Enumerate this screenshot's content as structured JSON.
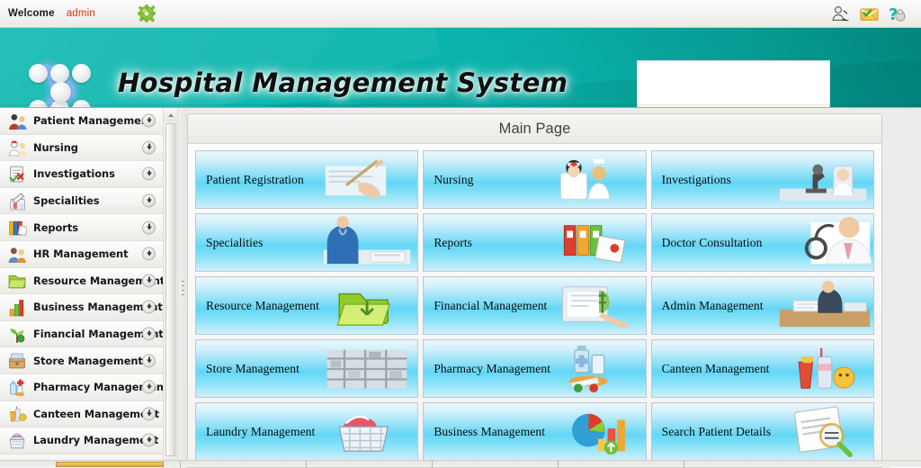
{
  "topbar": {
    "welcome_label": "Welcome",
    "user_name": "admin",
    "gear_icon": "gear-icon",
    "right_icons": [
      {
        "name": "user-account-icon",
        "glyph": "user"
      },
      {
        "name": "mail-envelope-icon",
        "glyph": "envelope"
      },
      {
        "name": "help-question-icon",
        "glyph": "question"
      }
    ]
  },
  "banner": {
    "title": "Hospital Management System",
    "logo_name": "molecule-logo",
    "placeholder_box_name": "banner-logo-placeholder"
  },
  "sidebar": {
    "items": [
      {
        "label": "Patient Management",
        "icon": "patients-icon"
      },
      {
        "label": "Nursing",
        "icon": "nurse-icon"
      },
      {
        "label": "Investigations",
        "icon": "clipboard-icon"
      },
      {
        "label": "Specialities",
        "icon": "specialities-icon"
      },
      {
        "label": "Reports",
        "icon": "binders-icon"
      },
      {
        "label": "HR Management",
        "icon": "people-icon"
      },
      {
        "label": "Resource Management",
        "icon": "folder-icon"
      },
      {
        "label": "Business Management",
        "icon": "bar-chart-icon"
      },
      {
        "label": "Financial Management",
        "icon": "money-plant-icon"
      },
      {
        "label": "Store Management",
        "icon": "store-box-icon"
      },
      {
        "label": "Pharmacy Management",
        "icon": "medicine-icon"
      },
      {
        "label": "Canteen Management",
        "icon": "food-icon"
      },
      {
        "label": "Laundry Management",
        "icon": "laundry-icon"
      }
    ],
    "expand_arrow_name": "expand-arrow-icon"
  },
  "main": {
    "page_title": "Main Page",
    "tiles": [
      {
        "label": "Patient Registration",
        "art": "hand-writing-form-art"
      },
      {
        "label": "Nursing",
        "art": "nurses-art"
      },
      {
        "label": "Investigations",
        "art": "microscope-lab-art"
      },
      {
        "label": "Specialities",
        "art": "doctor-scrubs-art"
      },
      {
        "label": "Reports",
        "art": "binders-files-art"
      },
      {
        "label": "Doctor Consultation",
        "art": "doctor-stethoscope-art"
      },
      {
        "label": "Resource Management",
        "art": "green-folder-art"
      },
      {
        "label": "Financial Management",
        "art": "tablet-money-art"
      },
      {
        "label": "Admin Management",
        "art": "office-desk-art"
      },
      {
        "label": "Store Management",
        "art": "warehouse-shelves-art"
      },
      {
        "label": "Pharmacy Management",
        "art": "pills-bottles-art"
      },
      {
        "label": "Canteen Management",
        "art": "fast-food-art"
      },
      {
        "label": "Laundry Management",
        "art": "laundry-basket-art"
      },
      {
        "label": "Business Management",
        "art": "pie-chart-art"
      },
      {
        "label": "Search Patient Details",
        "art": "magnifier-document-art"
      }
    ]
  },
  "colors": {
    "banner_teal": "#05b4ab",
    "tile_cyan": "#63d6f5",
    "admin_red": "#d03a12",
    "panel_gray": "#edecea"
  }
}
